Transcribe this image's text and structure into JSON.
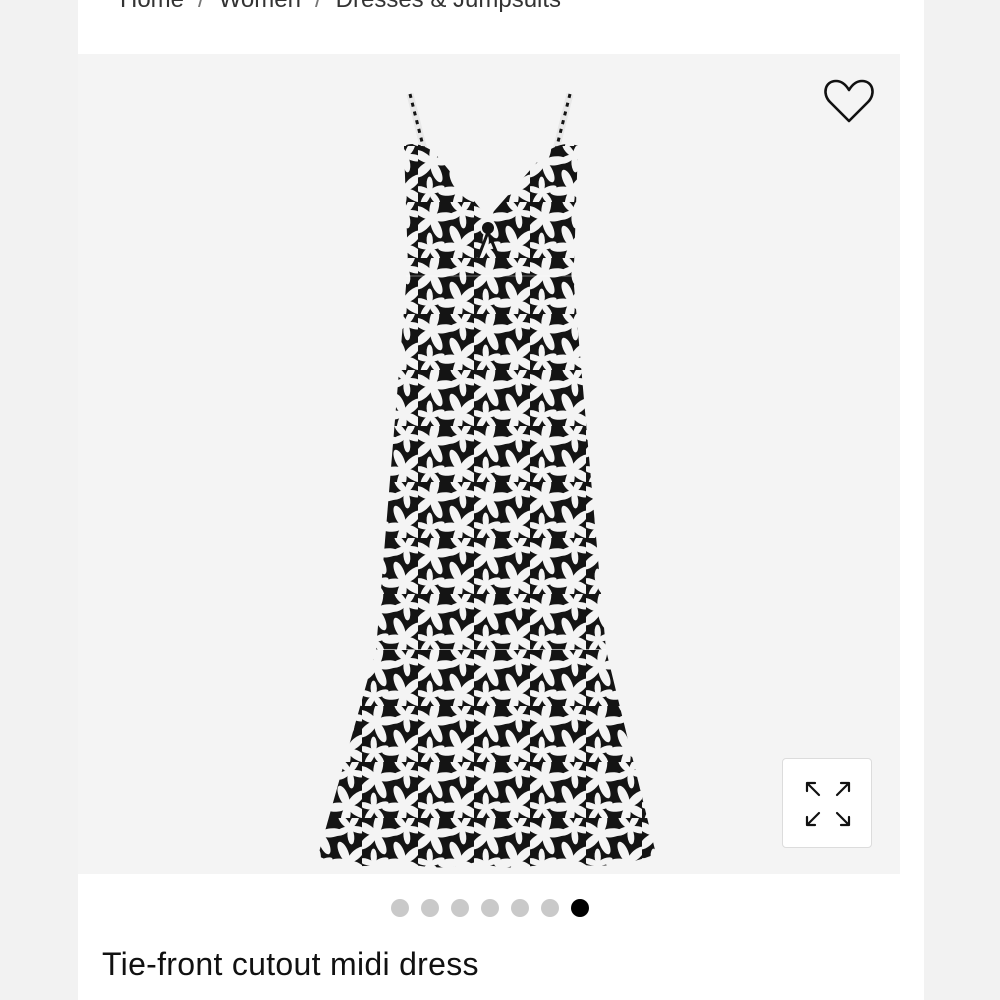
{
  "breadcrumb": {
    "items": [
      "Home",
      "Women",
      "Dresses & Jumpsuits"
    ],
    "separator": "/"
  },
  "product": {
    "title": "Tie-front cutout midi dress",
    "image_alt": "Black and white floral print tie-front cutout midi dress",
    "pattern_colors": {
      "base": "#141414",
      "flower": "#f4f4f4"
    }
  },
  "gallery": {
    "total_images": 7,
    "active_index": 7
  },
  "icons": {
    "wishlist": "heart-icon",
    "expand": "expand-icon"
  }
}
